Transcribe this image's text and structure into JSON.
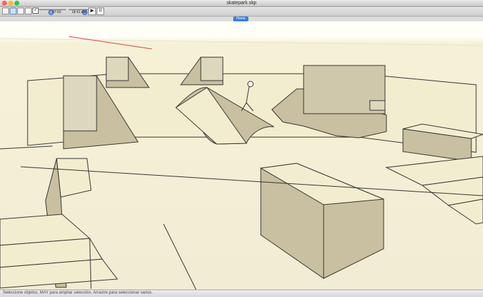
{
  "window": {
    "title": "skatepark.skp",
    "traffic_colors": [
      "#ff5f57",
      "#febc2e",
      "#28c840"
    ]
  },
  "toolbar": {
    "time_left": "07:50",
    "time_right": "18:41 AM",
    "play_label": "▶",
    "pause_label": "II",
    "sliders": [
      {
        "value": 0.35
      },
      {
        "value": 0.62
      }
    ]
  },
  "scene": {
    "active_tab": "Home"
  },
  "status": {
    "message": "Seleccione objetos. MAY para ampliar selección. Arrastre para seleccionar varios."
  }
}
